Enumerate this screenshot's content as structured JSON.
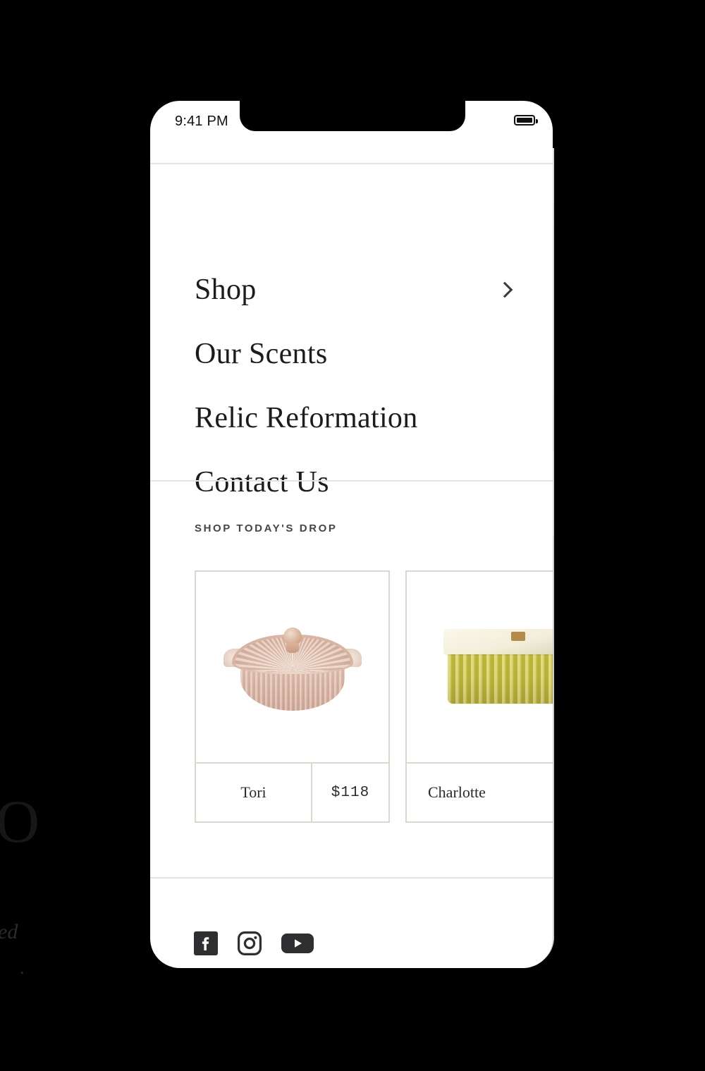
{
  "status_bar": {
    "time": "9:41 PM",
    "battery_icon": "battery-full-icon"
  },
  "navigation": {
    "items": [
      {
        "label": "Shop",
        "accessory_icon": "chevron-right-icon"
      },
      {
        "label": "Our Scents"
      },
      {
        "label": "Relic Reformation"
      },
      {
        "label": "Contact Us"
      }
    ]
  },
  "shop_section": {
    "title": "SHOP TODAY'S DROP",
    "products": [
      {
        "name": "Tori",
        "price": "$118",
        "image": "pink-lidded-glass-dish"
      },
      {
        "name": "Charlotte",
        "price": "",
        "image": "yellow-lidded-ceramic-box"
      }
    ]
  },
  "footer": {
    "social_links": [
      {
        "icon": "facebook-icon"
      },
      {
        "icon": "instagram-icon"
      },
      {
        "icon": "youtube-icon"
      }
    ]
  },
  "background": {
    "headline_fragment": "O",
    "italic_fragment": "ned",
    "period_fragment": "."
  },
  "colors": {
    "page_background": "#000000",
    "phone_surface": "#ffffff",
    "divider": "#e8e4dc",
    "card_border": "#ddd8cf",
    "text_primary": "#1c1c1e",
    "text_secondary": "#46464a",
    "icon_dark": "#2f2f31",
    "background_layer": "#cecec9"
  }
}
